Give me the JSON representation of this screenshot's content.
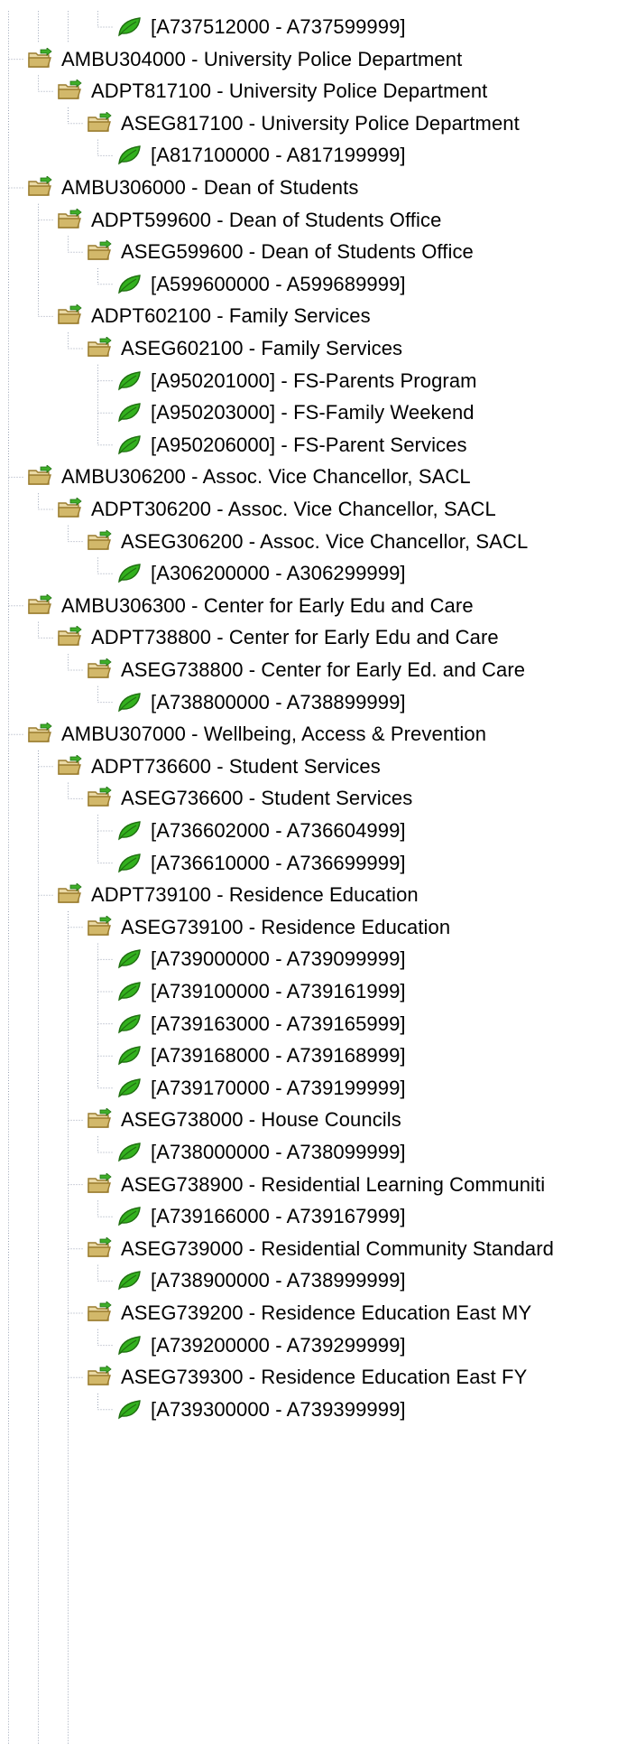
{
  "colors": {
    "guide_line": "#9aa3b5",
    "folder_body": "#ead9a5",
    "folder_tab": "#d2b86a",
    "folder_outline": "#9a7c2e",
    "arrow_green": "#3fae2a",
    "leaf_green": "#33b11e",
    "leaf_outline": "#1f6f10"
  },
  "tree": {
    "nodes": [
      {
        "label": "[A737512000 - A737599999]",
        "level": 3,
        "type": "leaf",
        "last": true
      },
      {
        "label": "AMBU304000 - University Police Department",
        "level": 0,
        "type": "folder",
        "last": false
      },
      {
        "label": "ADPT817100 - University Police Department",
        "level": 1,
        "type": "folder",
        "last": true
      },
      {
        "label": "ASEG817100 - University Police Department",
        "level": 2,
        "type": "folder",
        "last": true
      },
      {
        "label": "[A817100000 - A817199999]",
        "level": 3,
        "type": "leaf",
        "last": true
      },
      {
        "label": "AMBU306000 - Dean of Students",
        "level": 0,
        "type": "folder",
        "last": false
      },
      {
        "label": "ADPT599600 - Dean of Students Office",
        "level": 1,
        "type": "folder",
        "last": false
      },
      {
        "label": "ASEG599600 - Dean of Students Office",
        "level": 2,
        "type": "folder",
        "last": true
      },
      {
        "label": "[A599600000 - A599689999]",
        "level": 3,
        "type": "leaf",
        "last": true
      },
      {
        "label": "ADPT602100 - Family Services",
        "level": 1,
        "type": "folder",
        "last": true
      },
      {
        "label": "ASEG602100 - Family Services",
        "level": 2,
        "type": "folder",
        "last": true
      },
      {
        "label": "[A950201000] - FS-Parents Program",
        "level": 3,
        "type": "leaf",
        "last": false
      },
      {
        "label": "[A950203000] - FS-Family Weekend",
        "level": 3,
        "type": "leaf",
        "last": false
      },
      {
        "label": "[A950206000] - FS-Parent Services",
        "level": 3,
        "type": "leaf",
        "last": true
      },
      {
        "label": "AMBU306200 - Assoc. Vice Chancellor, SACL",
        "level": 0,
        "type": "folder",
        "last": false
      },
      {
        "label": "ADPT306200 - Assoc. Vice Chancellor, SACL",
        "level": 1,
        "type": "folder",
        "last": true
      },
      {
        "label": "ASEG306200 - Assoc. Vice Chancellor, SACL",
        "level": 2,
        "type": "folder",
        "last": true
      },
      {
        "label": "[A306200000 - A306299999]",
        "level": 3,
        "type": "leaf",
        "last": true
      },
      {
        "label": "AMBU306300 - Center for Early Edu and Care",
        "level": 0,
        "type": "folder",
        "last": false
      },
      {
        "label": "ADPT738800 - Center for Early Edu and Care",
        "level": 1,
        "type": "folder",
        "last": true
      },
      {
        "label": "ASEG738800 - Center for Early Ed. and Care",
        "level": 2,
        "type": "folder",
        "last": true
      },
      {
        "label": "[A738800000 - A738899999]",
        "level": 3,
        "type": "leaf",
        "last": true
      },
      {
        "label": "AMBU307000 - Wellbeing, Access & Prevention",
        "level": 0,
        "type": "folder",
        "last": false
      },
      {
        "label": "ADPT736600 - Student Services",
        "level": 1,
        "type": "folder",
        "last": false
      },
      {
        "label": "ASEG736600 - Student Services",
        "level": 2,
        "type": "folder",
        "last": true
      },
      {
        "label": "[A736602000 - A736604999]",
        "level": 3,
        "type": "leaf",
        "last": false
      },
      {
        "label": "[A736610000 - A736699999]",
        "level": 3,
        "type": "leaf",
        "last": true
      },
      {
        "label": "ADPT739100 - Residence Education",
        "level": 1,
        "type": "folder",
        "last": false
      },
      {
        "label": "ASEG739100 - Residence Education",
        "level": 2,
        "type": "folder",
        "last": false
      },
      {
        "label": "[A739000000 - A739099999]",
        "level": 3,
        "type": "leaf",
        "last": false
      },
      {
        "label": "[A739100000 - A739161999]",
        "level": 3,
        "type": "leaf",
        "last": false
      },
      {
        "label": "[A739163000 - A739165999]",
        "level": 3,
        "type": "leaf",
        "last": false
      },
      {
        "label": "[A739168000 - A739168999]",
        "level": 3,
        "type": "leaf",
        "last": false
      },
      {
        "label": "[A739170000 - A739199999]",
        "level": 3,
        "type": "leaf",
        "last": true
      },
      {
        "label": "ASEG738000 - House Councils",
        "level": 2,
        "type": "folder",
        "last": false
      },
      {
        "label": "[A738000000 - A738099999]",
        "level": 3,
        "type": "leaf",
        "last": true
      },
      {
        "label": "ASEG738900 - Residential Learning Communiti",
        "level": 2,
        "type": "folder",
        "last": false
      },
      {
        "label": "[A739166000 - A739167999]",
        "level": 3,
        "type": "leaf",
        "last": true
      },
      {
        "label": "ASEG739000 - Residential Community Standard",
        "level": 2,
        "type": "folder",
        "last": false
      },
      {
        "label": "[A738900000 - A738999999]",
        "level": 3,
        "type": "leaf",
        "last": true
      },
      {
        "label": "ASEG739200 - Residence Education East MY",
        "level": 2,
        "type": "folder",
        "last": false
      },
      {
        "label": "[A739200000 - A739299999]",
        "level": 3,
        "type": "leaf",
        "last": true
      },
      {
        "label": "ASEG739300 - Residence Education East FY",
        "level": 2,
        "type": "folder",
        "last": false
      },
      {
        "label": "[A739300000 - A739399999]",
        "level": 3,
        "type": "leaf",
        "last": true
      }
    ]
  }
}
